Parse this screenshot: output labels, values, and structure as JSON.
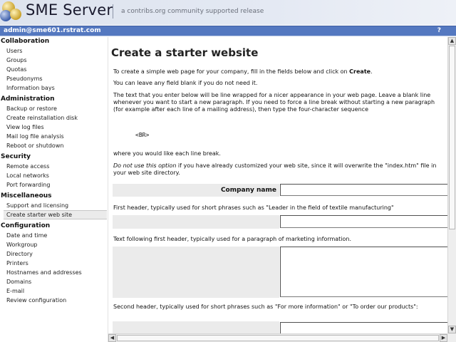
{
  "header": {
    "brand": "SME Server",
    "tagline": "a contribs.org community supported release"
  },
  "userbar": {
    "user": "admin@sme601.rstrat.com",
    "help": "?"
  },
  "sidebar": {
    "sections": [
      {
        "heading": "Collaboration",
        "items": [
          "Users",
          "Groups",
          "Quotas",
          "Pseudonyms",
          "Information bays"
        ]
      },
      {
        "heading": "Administration",
        "items": [
          "Backup or restore",
          "Create reinstallation disk",
          "View log files",
          "Mail log file analysis",
          "Reboot or shutdown"
        ]
      },
      {
        "heading": "Security",
        "items": [
          "Remote access",
          "Local networks",
          "Port forwarding"
        ]
      },
      {
        "heading": "Miscellaneous",
        "items": [
          "Support and licensing",
          "Create starter web site"
        ]
      },
      {
        "heading": "Configuration",
        "items": [
          "Date and time",
          "Workgroup",
          "Directory",
          "Printers",
          "Hostnames and addresses",
          "Domains",
          "E-mail",
          "Review configuration"
        ]
      }
    ],
    "active_item": "Create starter web site"
  },
  "main": {
    "title": "Create a starter website",
    "intro_pre": "To create a simple web page for your company, fill in the fields below and click on ",
    "intro_bold": "Create",
    "intro_post": ".",
    "blank_note": "You can leave any field blank if you do not need it.",
    "wrap_note": "The text that you enter below will be line wrapped for a nicer appearance in your web page. Leave a blank line whenever you want to start a new paragraph. If you need to force a line break without starting a new paragraph (for example after each line of a mailing address), then type the four-character sequence",
    "br_code": "<BR>",
    "where_note": "where you would like each line break.",
    "warning_italic": "Do not use this option",
    "warning_rest": " if you have already customized your web site, since it will overwrite the \"index.htm\" file in your web site directory.",
    "company_label": "Company name",
    "company_value": "",
    "header1_desc": "First header, typically used for short phrases such as \"Leader in the field of textile manufacturing\"",
    "header1_value": "",
    "text1_desc": "Text following first header, typically used for a paragraph of marketing information.",
    "text1_value": "",
    "header2_desc": "Second header, typically used for short phrases such as \"For more information\" or \"To order our products\":",
    "header2_value": ""
  },
  "scrollbars": {
    "up": "▲",
    "down": "▼",
    "left": "◀",
    "right": "▶"
  }
}
